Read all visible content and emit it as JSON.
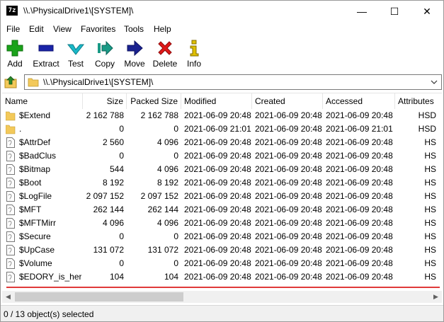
{
  "window": {
    "app_icon_text": "7z",
    "title": "\\\\.\\PhysicalDrive1\\[SYSTEM]\\",
    "controls": {
      "minimize": "—",
      "maximize": "☐",
      "close": "✕"
    }
  },
  "menu": [
    {
      "label": "File"
    },
    {
      "label": "Edit"
    },
    {
      "label": "View"
    },
    {
      "label": "Favorites"
    },
    {
      "label": "Tools"
    },
    {
      "label": "Help"
    }
  ],
  "toolbar": [
    {
      "label": "Add",
      "icon": "plus-icon",
      "color": "#1aa31a"
    },
    {
      "label": "Extract",
      "icon": "minus-icon",
      "color": "#1a24a8"
    },
    {
      "label": "Test",
      "icon": "checkmark-icon",
      "color": "#1ab8c8"
    },
    {
      "label": "Copy",
      "icon": "copy-arrow-icon",
      "color": "#1a9a86"
    },
    {
      "label": "Move",
      "icon": "move-arrow-icon",
      "color": "#1a2290"
    },
    {
      "label": "Delete",
      "icon": "x-icon",
      "color": "#e01818"
    },
    {
      "label": "Info",
      "icon": "info-icon",
      "color": "#e0c000"
    }
  ],
  "address": {
    "path": "\\\\.\\PhysicalDrive1\\[SYSTEM]\\",
    "dropdown_glyph": "⌄"
  },
  "columns": [
    "Name",
    "Size",
    "Packed Size",
    "Modified",
    "Created",
    "Accessed",
    "Attributes"
  ],
  "files": [
    {
      "name": "$Extend",
      "type": "folder",
      "size": "2 162 788",
      "packed": "2 162 788",
      "modified": "2021-06-09 20:48",
      "created": "2021-06-09 20:48",
      "accessed": "2021-06-09 20:48",
      "attributes": "HSD"
    },
    {
      "name": ".",
      "type": "folder",
      "size": "0",
      "packed": "0",
      "modified": "2021-06-09 21:01",
      "created": "2021-06-09 20:48",
      "accessed": "2021-06-09 21:01",
      "attributes": "HSD"
    },
    {
      "name": "$AttrDef",
      "type": "file",
      "size": "2 560",
      "packed": "4 096",
      "modified": "2021-06-09 20:48",
      "created": "2021-06-09 20:48",
      "accessed": "2021-06-09 20:48",
      "attributes": "HS"
    },
    {
      "name": "$BadClus",
      "type": "file",
      "size": "0",
      "packed": "0",
      "modified": "2021-06-09 20:48",
      "created": "2021-06-09 20:48",
      "accessed": "2021-06-09 20:48",
      "attributes": "HS"
    },
    {
      "name": "$Bitmap",
      "type": "file",
      "size": "544",
      "packed": "4 096",
      "modified": "2021-06-09 20:48",
      "created": "2021-06-09 20:48",
      "accessed": "2021-06-09 20:48",
      "attributes": "HS"
    },
    {
      "name": "$Boot",
      "type": "file",
      "size": "8 192",
      "packed": "8 192",
      "modified": "2021-06-09 20:48",
      "created": "2021-06-09 20:48",
      "accessed": "2021-06-09 20:48",
      "attributes": "HS"
    },
    {
      "name": "$LogFile",
      "type": "file",
      "size": "2 097 152",
      "packed": "2 097 152",
      "modified": "2021-06-09 20:48",
      "created": "2021-06-09 20:48",
      "accessed": "2021-06-09 20:48",
      "attributes": "HS"
    },
    {
      "name": "$MFT",
      "type": "file",
      "size": "262 144",
      "packed": "262 144",
      "modified": "2021-06-09 20:48",
      "created": "2021-06-09 20:48",
      "accessed": "2021-06-09 20:48",
      "attributes": "HS"
    },
    {
      "name": "$MFTMirr",
      "type": "file",
      "size": "4 096",
      "packed": "4 096",
      "modified": "2021-06-09 20:48",
      "created": "2021-06-09 20:48",
      "accessed": "2021-06-09 20:48",
      "attributes": "HS"
    },
    {
      "name": "$Secure",
      "type": "file",
      "size": "0",
      "packed": "0",
      "modified": "2021-06-09 20:48",
      "created": "2021-06-09 20:48",
      "accessed": "2021-06-09 20:48",
      "attributes": "HS"
    },
    {
      "name": "$UpCase",
      "type": "file",
      "size": "131 072",
      "packed": "131 072",
      "modified": "2021-06-09 20:48",
      "created": "2021-06-09 20:48",
      "accessed": "2021-06-09 20:48",
      "attributes": "HS"
    },
    {
      "name": "$Volume",
      "type": "file",
      "size": "0",
      "packed": "0",
      "modified": "2021-06-09 20:48",
      "created": "2021-06-09 20:48",
      "accessed": "2021-06-09 20:48",
      "attributes": "HS"
    },
    {
      "name": "$EDORY_is_here!",
      "type": "file",
      "size": "104",
      "packed": "104",
      "modified": "2021-06-09 20:48",
      "created": "2021-06-09 20:48",
      "accessed": "2021-06-09 20:48",
      "attributes": "HS"
    }
  ],
  "scrollbar": {
    "left_arrow": "◀",
    "right_arrow": "▶"
  },
  "status": "0 / 13 object(s) selected",
  "colors": {
    "highlight_line": "#e03a3a",
    "folder": "#f3c95a"
  }
}
